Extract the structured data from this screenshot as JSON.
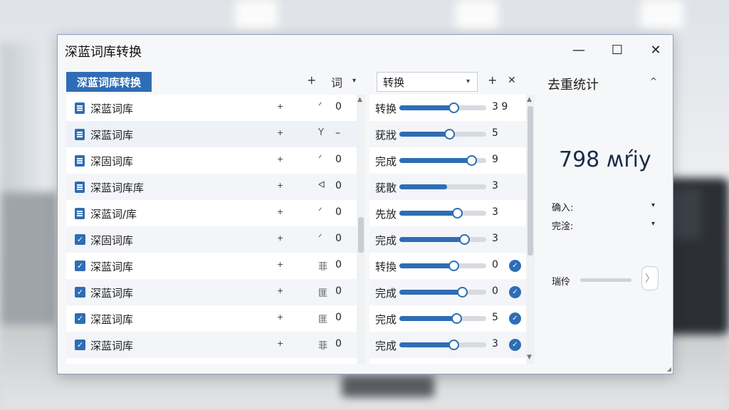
{
  "window": {
    "title": "深蓝词库转换",
    "minimize_glyph": "—",
    "maximize_glyph": "☐",
    "close_glyph": "✕"
  },
  "toolbar": {
    "active_tab": "深蓝词库转换",
    "add_glyph": "+",
    "word_label": "词",
    "word_caret": "▾",
    "dropdown_value": "转换",
    "dropdown_caret": "▾",
    "add2_glyph": "+",
    "close2_glyph": "✕"
  },
  "list": {
    "rows": [
      {
        "icon": "doc-icon",
        "name": "深蓝词库",
        "plus": "+",
        "mark": "ᐟ",
        "count": "0"
      },
      {
        "icon": "doc-icon",
        "name": "深蓝词库",
        "plus": "+",
        "mark": "Y",
        "count": "–"
      },
      {
        "icon": "doc-icon",
        "name": "深固词库",
        "plus": "+",
        "mark": "ᐟ",
        "count": "0"
      },
      {
        "icon": "doc-icon",
        "name": "深蓝词库库",
        "plus": "+",
        "mark": "ᐊ",
        "count": "0"
      },
      {
        "icon": "doc-icon",
        "name": "深蓝词/库",
        "plus": "+",
        "mark": "ᐟ",
        "count": "0"
      },
      {
        "icon": "check-icon",
        "name": "深固词库",
        "plus": "+",
        "mark": "ᐟ",
        "count": "0"
      },
      {
        "icon": "check-icon",
        "name": "深蓝词库",
        "plus": "+",
        "mark": "菲",
        "count": "0"
      },
      {
        "icon": "check-icon",
        "name": "深蓝词库",
        "plus": "+",
        "mark": "匪",
        "count": "0"
      },
      {
        "icon": "check-icon",
        "name": "深蓝词库",
        "plus": "+",
        "mark": "匪",
        "count": "0"
      },
      {
        "icon": "check-icon",
        "name": "深蓝词库",
        "plus": "+",
        "mark": "菲",
        "count": "0"
      }
    ]
  },
  "progress": {
    "rows": [
      {
        "label": "转换",
        "value": "3 9",
        "level": 0.63,
        "knob": true,
        "done": false
      },
      {
        "label": "莸戕",
        "value": "5",
        "level": 0.58,
        "knob": true,
        "done": false
      },
      {
        "label": "完成",
        "value": "9",
        "level": 0.84,
        "knob": true,
        "done": false
      },
      {
        "label": "莸散",
        "value": "3",
        "level": 0.55,
        "knob": false,
        "done": false
      },
      {
        "label": "先放",
        "value": "3",
        "level": 0.67,
        "knob": true,
        "done": false
      },
      {
        "label": "完成",
        "value": "3",
        "level": 0.75,
        "knob": true,
        "done": false
      },
      {
        "label": "转換",
        "value": "0",
        "level": 0.63,
        "knob": true,
        "done": true
      },
      {
        "label": "完成",
        "value": "0",
        "level": 0.73,
        "knob": true,
        "done": true
      },
      {
        "label": "完成",
        "value": "5",
        "level": 0.66,
        "knob": true,
        "done": true
      },
      {
        "label": "完成",
        "value": "3",
        "level": 0.63,
        "knob": true,
        "done": true
      }
    ],
    "check_glyph": "✓"
  },
  "stats": {
    "title": "去重统计",
    "collapse_glyph": "^",
    "big_value": "798 ʍŕiy",
    "input_label": "确入:",
    "done_label": "完淦:",
    "caret": "▾",
    "slider_label": "瑞伶",
    "slider_level": 0.0,
    "next_glyph": "〉"
  },
  "colors": {
    "accent": "#2e6db5",
    "track": "#d7dbe0"
  }
}
